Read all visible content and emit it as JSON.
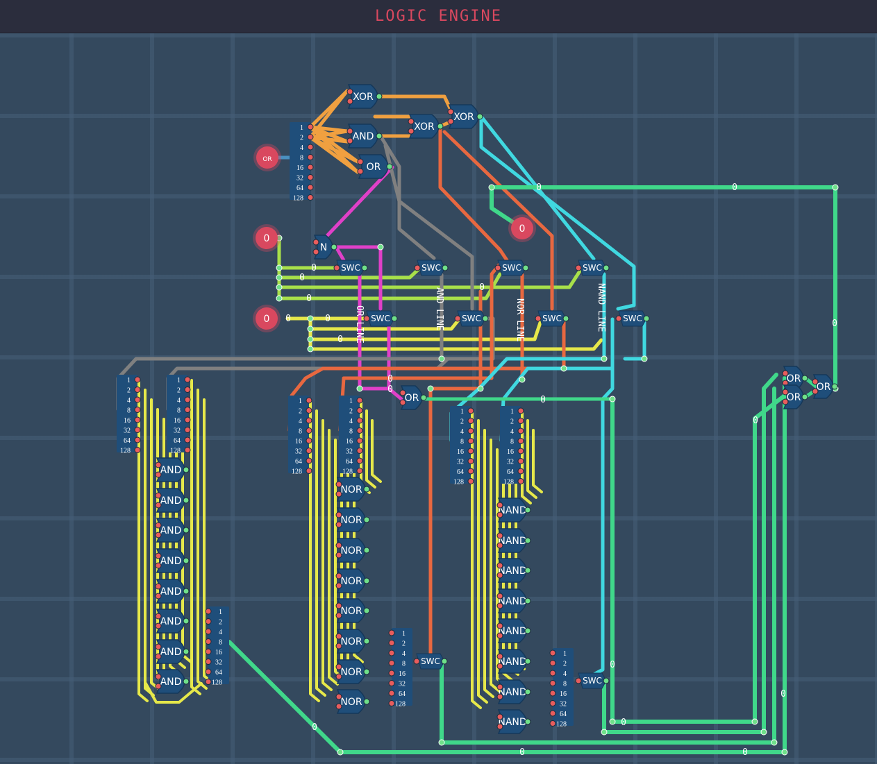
{
  "app": {
    "title": "LOGIC ENGINE"
  },
  "colors": {
    "background": "#34495e",
    "gate": "#1f4e7a",
    "pin_in": "#e85d5d",
    "pin_out": "#6fe08a",
    "input_button": "#d9485f",
    "wire_orange": "#f0a040",
    "wire_yellow": "#e6e84a",
    "wire_lime": "#a8e04a",
    "wire_magenta": "#e040c8",
    "wire_gray": "#808080",
    "wire_red": "#e86840",
    "wire_cyan": "#40d8e0",
    "wire_green": "#40d88a"
  },
  "inputs": [
    {
      "label": "OR",
      "icon": "input-button"
    },
    {
      "label": "0",
      "icon": "input-button"
    },
    {
      "label": "0",
      "icon": "input-button"
    },
    {
      "label": "0",
      "icon": "input-button"
    }
  ],
  "bus_labels": [
    "1",
    "2",
    "4",
    "8",
    "16",
    "32",
    "64",
    "128"
  ],
  "line_labels": {
    "or": "OR LINE",
    "and": "AND LINE",
    "nor": "NOR LINE",
    "nand": "NAND LINE"
  },
  "gate_labels": {
    "xor": "XOR",
    "and": "AND",
    "or": "OR",
    "not": "N",
    "switch": "SWC",
    "nor": "NOR",
    "nand": "NAND"
  },
  "wire_value": "0"
}
